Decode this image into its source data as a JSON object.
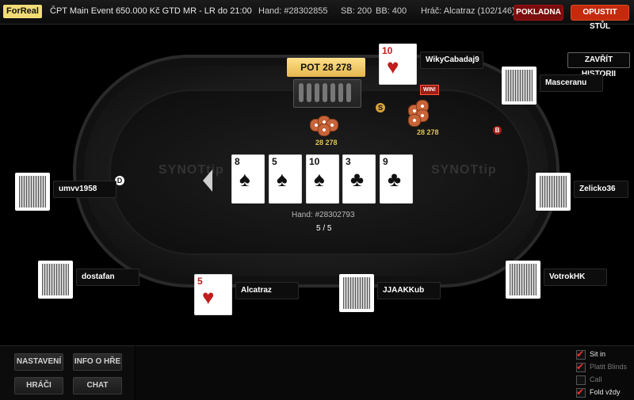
{
  "header": {
    "brand": "ForReal",
    "title": "ČPT Main Event 650.000 Kč GTD MR - LR do 21:00",
    "hand_no": "Hand: #28302855",
    "sb": "SB: 200",
    "bb": "BB: 400",
    "player": "Hráč: Alcatraz (102/146)",
    "cashier_label": "POKLADNA",
    "leave_label": "OPUSTIT STŮL"
  },
  "history_close_label": "ZAVŘÍT HISTORII",
  "table": {
    "pot_label": "POT 28 278",
    "brand_watermark": "SYNOTtip",
    "hand_label": "Hand: #28302793",
    "progress": "5 / 5",
    "dealer_badge": "D",
    "small_blind_badge": "S",
    "big_blind_badge": "B"
  },
  "board": [
    {
      "rank": "8",
      "suit": "♠",
      "color": "black"
    },
    {
      "rank": "5",
      "suit": "♠",
      "color": "black"
    },
    {
      "rank": "10",
      "suit": "♠",
      "color": "black"
    },
    {
      "rank": "3",
      "suit": "♣",
      "color": "black"
    },
    {
      "rank": "9",
      "suit": "♣",
      "color": "black"
    }
  ],
  "stacks": {
    "left_amount": "28 278",
    "right_amount": "28 278",
    "chip_label": "1K"
  },
  "players": {
    "wiky": {
      "name": "WikyCabadaj9",
      "card_rank": "10",
      "card_suit": "♥",
      "win_badge": "WIN!"
    },
    "masceranu": {
      "name": "Masceranu"
    },
    "umvv": {
      "name": "umvv1958"
    },
    "zelicko": {
      "name": "Zelicko36"
    },
    "dostafan": {
      "name": "dostafan"
    },
    "alcatraz": {
      "name": "Alcatraz",
      "card_rank": "5",
      "card_suit": "♥"
    },
    "jjaak": {
      "name": "JJAAKKub"
    },
    "votrok": {
      "name": "VotrokHK"
    }
  },
  "controls": {
    "settings_label": "NASTAVENÍ",
    "info_label": "INFO O HŘE",
    "players_label": "HRÁČI",
    "chat_label": "CHAT"
  },
  "options": [
    {
      "label": "Sit in",
      "checked": true
    },
    {
      "label": "Platit Blinds",
      "checked": true
    },
    {
      "label": "Call",
      "checked": false
    },
    {
      "label": "Fold vždy",
      "checked": true
    }
  ]
}
